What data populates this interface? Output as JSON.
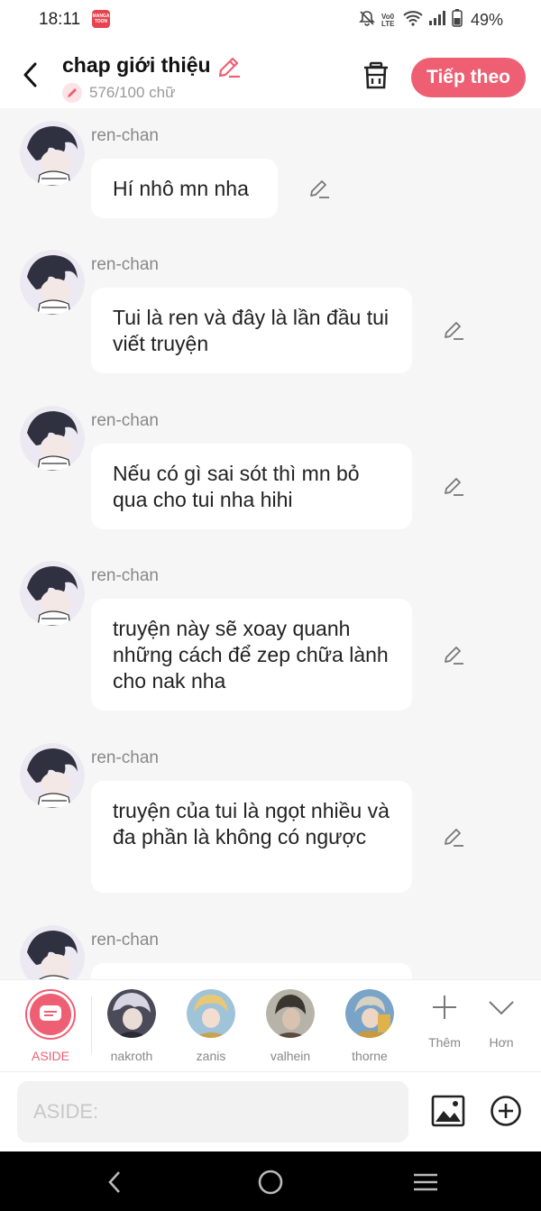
{
  "status_bar": {
    "time": "18:11",
    "app_icon_text": "MANGA TOON",
    "network_text": "Vo0 LTE",
    "battery": "49%"
  },
  "header": {
    "title": "chap giới thiệu",
    "word_count": "576/100 chữ",
    "next_button": "Tiếp theo",
    "accent_color": "#ef5f73"
  },
  "messages": [
    {
      "sender": "ren-chan",
      "text": "Hí nhô mn nha"
    },
    {
      "sender": "ren-chan",
      "text": "Tui là ren và đây là lần đầu tui viết truyện"
    },
    {
      "sender": "ren-chan",
      "text": "Nếu có gì sai sót thì mn bỏ qua cho tui nha hihi"
    },
    {
      "sender": "ren-chan",
      "text": "truyện này sẽ xoay quanh những cách để zep chữa lành cho nak nha"
    },
    {
      "sender": "ren-chan",
      "text": "truyện của tui là ngọt nhiều và đa phần là không có ngược"
    },
    {
      "sender": "ren-chan",
      "text": ""
    }
  ],
  "characters": [
    {
      "name": "ASIDE",
      "selected": true
    },
    {
      "name": "nakroth"
    },
    {
      "name": "zanis"
    },
    {
      "name": "valhein"
    },
    {
      "name": "thorne"
    }
  ],
  "tools": {
    "add_label": "Thêm",
    "more_label": "Hơn"
  },
  "input": {
    "placeholder": "ASIDE:"
  }
}
